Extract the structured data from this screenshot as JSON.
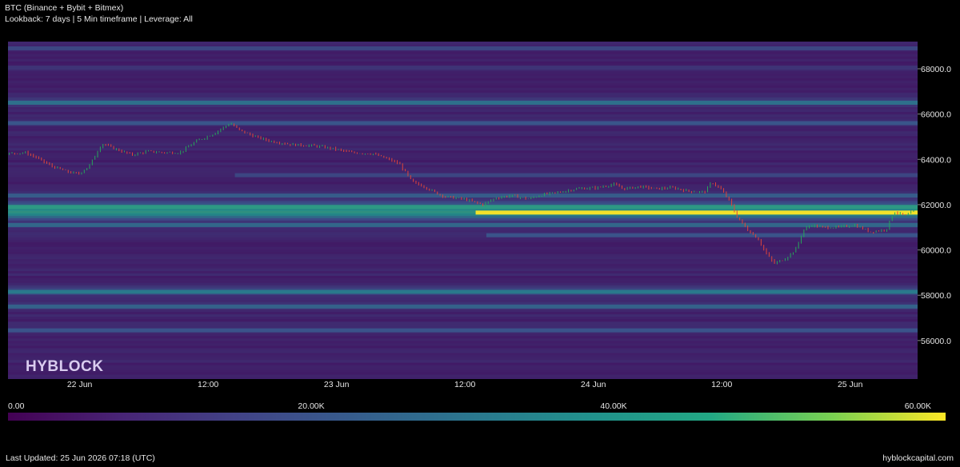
{
  "header": {
    "title": "BTC (Binance + Bybit + Bitmex)",
    "subtitle": "Lookback: 7 days | 5 Min timeframe | Leverage: All"
  },
  "watermark": "HYBLOCK",
  "footer": {
    "last_updated": "Last Updated: 25 Jun 2026 07:18 (UTC)",
    "site": "hyblockcapital.com"
  },
  "colors": {
    "background": "#000000",
    "candle_up": "#26a65b",
    "candle_down": "#e0453a",
    "heat_low": "#440154",
    "heat_mid": "#21918c",
    "heat_high": "#fde725"
  },
  "chart_data": {
    "type": "heatmap",
    "title": "BTC (Binance + Bybit + Bitmex)",
    "x_ticks": [
      "22 Jun",
      "12:00",
      "23 Jun",
      "12:00",
      "24 Jun",
      "12:00",
      "25 Jun"
    ],
    "y_ticks": [
      "56000.0",
      "58000.0",
      "60000.0",
      "62000.0",
      "64000.0",
      "66000.0",
      "68000.0"
    ],
    "ylim": [
      54300,
      69200
    ],
    "x_hours": [
      2,
      14,
      26,
      38,
      50,
      62,
      74
    ],
    "x_range_hours": [
      -4.7,
      80.3
    ],
    "colorbar": {
      "ticks": [
        "0.00",
        "20.00K",
        "40.00K",
        "60.00K"
      ],
      "range": [
        0,
        60000
      ]
    },
    "price_series": [
      [
        -4.7,
        64250
      ],
      [
        -3.0,
        64300
      ],
      [
        -2.0,
        64100
      ],
      [
        -0.5,
        63700
      ],
      [
        1.0,
        63450
      ],
      [
        2.0,
        63350
      ],
      [
        3.0,
        63700
      ],
      [
        4.2,
        64700
      ],
      [
        5.5,
        64450
      ],
      [
        7.0,
        64200
      ],
      [
        8.5,
        64350
      ],
      [
        10.0,
        64300
      ],
      [
        11.5,
        64300
      ],
      [
        13.0,
        64800
      ],
      [
        14.5,
        65100
      ],
      [
        16.2,
        65600
      ],
      [
        17.0,
        65300
      ],
      [
        18.5,
        65000
      ],
      [
        20.0,
        64800
      ],
      [
        22.0,
        64650
      ],
      [
        24.0,
        64600
      ],
      [
        25.5,
        64500
      ],
      [
        27.5,
        64300
      ],
      [
        29.5,
        64250
      ],
      [
        31.0,
        64000
      ],
      [
        32.0,
        63800
      ],
      [
        33.2,
        63000
      ],
      [
        34.3,
        62800
      ],
      [
        35.5,
        62500
      ],
      [
        36.3,
        62350
      ],
      [
        38.0,
        62250
      ],
      [
        39.8,
        62000
      ],
      [
        41.0,
        62300
      ],
      [
        42.5,
        62400
      ],
      [
        44.0,
        62250
      ],
      [
        45.5,
        62450
      ],
      [
        47.0,
        62550
      ],
      [
        48.5,
        62700
      ],
      [
        50.5,
        62750
      ],
      [
        52.0,
        62900
      ],
      [
        53.0,
        62700
      ],
      [
        54.5,
        62800
      ],
      [
        56.0,
        62700
      ],
      [
        57.5,
        62750
      ],
      [
        59.0,
        62600
      ],
      [
        60.5,
        62550
      ],
      [
        61.2,
        63000
      ],
      [
        62.0,
        62700
      ],
      [
        62.8,
        62200
      ],
      [
        63.5,
        61500
      ],
      [
        64.5,
        60900
      ],
      [
        65.5,
        60500
      ],
      [
        66.2,
        59900
      ],
      [
        67.0,
        59400
      ],
      [
        68.0,
        59600
      ],
      [
        69.0,
        60000
      ],
      [
        69.8,
        60900
      ],
      [
        70.5,
        61100
      ],
      [
        71.5,
        61000
      ],
      [
        73.0,
        61000
      ],
      [
        74.5,
        61100
      ],
      [
        76.0,
        60800
      ],
      [
        77.5,
        60900
      ],
      [
        78.2,
        61700
      ],
      [
        79.3,
        61500
      ],
      [
        80.3,
        61800
      ]
    ],
    "liquidation_bands": [
      {
        "price": 68900,
        "intensity": 0.22,
        "from": -4.7
      },
      {
        "price": 68050,
        "intensity": 0.16,
        "from": -4.7
      },
      {
        "price": 66500,
        "intensity": 0.38,
        "from": -4.7
      },
      {
        "price": 65600,
        "intensity": 0.27,
        "from": -4.7
      },
      {
        "price": 63300,
        "intensity": 0.22,
        "from": 16.5
      },
      {
        "price": 62400,
        "intensity": 0.3,
        "from": -4.7
      },
      {
        "price": 61900,
        "intensity": 0.55,
        "from": -4.7
      },
      {
        "price": 61650,
        "intensity": 1.0,
        "from": 39.0
      },
      {
        "price": 61100,
        "intensity": 0.34,
        "from": -4.7
      },
      {
        "price": 60650,
        "intensity": 0.26,
        "from": 40.0
      },
      {
        "price": 58150,
        "intensity": 0.42,
        "from": -4.7
      },
      {
        "price": 57500,
        "intensity": 0.32,
        "from": -4.7
      },
      {
        "price": 56450,
        "intensity": 0.26,
        "from": -4.7
      }
    ]
  }
}
